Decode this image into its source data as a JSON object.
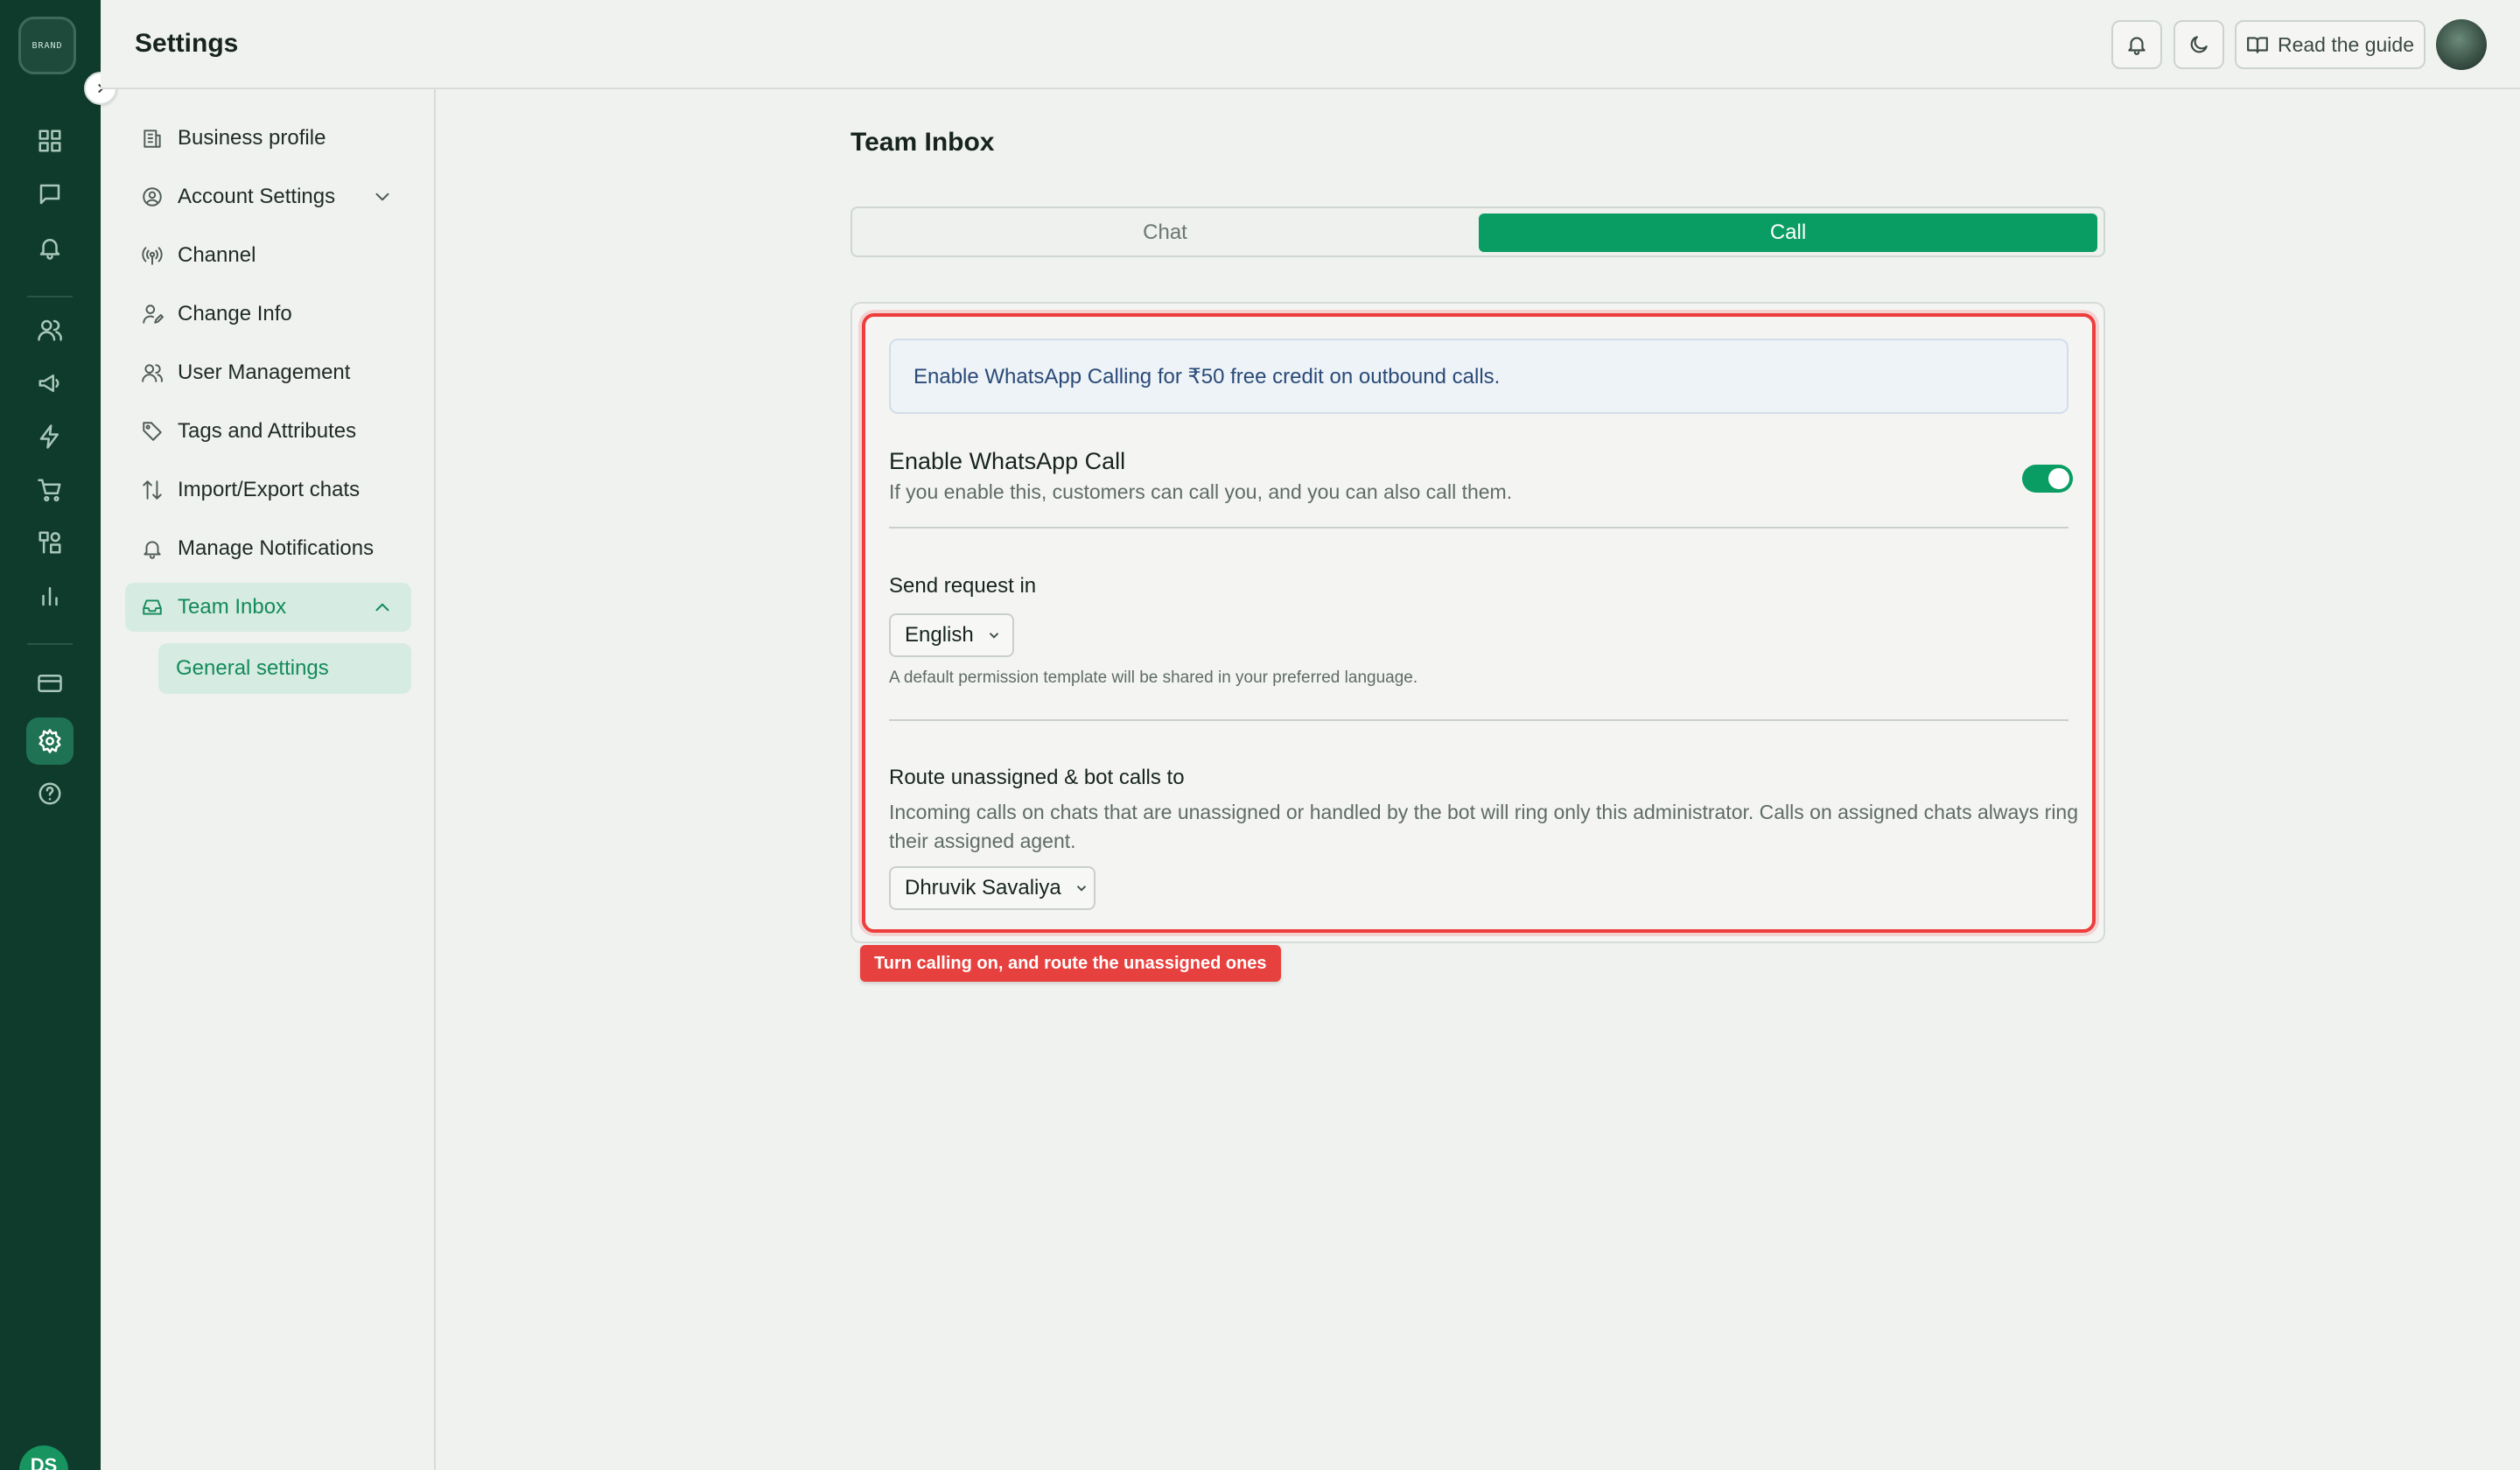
{
  "app": {
    "logo_text": "BRAND",
    "user_initials": "DS"
  },
  "header": {
    "title": "Settings",
    "guide_label": "Read the guide"
  },
  "rail": {
    "icons": [
      "dashboard-icon",
      "chat-icon",
      "bell-icon",
      "contacts-icon",
      "megaphone-icon",
      "lightning-icon",
      "cart-icon",
      "integrations-icon",
      "analytics-icon",
      "billing-icon",
      "settings-icon",
      "help-icon"
    ],
    "active": "settings-icon"
  },
  "nav": {
    "items": [
      {
        "label": "Business profile",
        "icon": "building-icon"
      },
      {
        "label": "Account Settings",
        "icon": "user-circle-icon"
      },
      {
        "label": "Channel",
        "icon": "broadcast-icon"
      },
      {
        "label": "Change Info",
        "icon": "user-edit-icon"
      },
      {
        "label": "User Management",
        "icon": "users-icon"
      },
      {
        "label": "Tags and Attributes",
        "icon": "tag-icon"
      },
      {
        "label": "Import/Export chats",
        "icon": "arrows-updown-icon"
      },
      {
        "label": "Manage Notifications",
        "icon": "bell-icon"
      },
      {
        "label": "Team Inbox",
        "icon": "inbox-icon"
      }
    ],
    "sub_item": "General settings"
  },
  "main": {
    "title": "Team Inbox",
    "tabs": [
      {
        "label": "Chat",
        "selected": false
      },
      {
        "label": "Call",
        "selected": true
      }
    ],
    "promo": "Enable WhatsApp Calling for ₹50 free credit on outbound calls.",
    "enable_call": {
      "title": "Enable WhatsApp Call",
      "description": "If you enable this, customers can call you, and you can also call them.",
      "enabled": true
    },
    "send_request": {
      "title": "Send request in",
      "value": "English",
      "hint": "A default permission template will be shared in your preferred language."
    },
    "route": {
      "title": "Route unassigned & bot calls to",
      "description": "Incoming calls on chats that are unassigned or handled by the bot will ring only this administrator. Calls on assigned chats always ring their assigned agent.",
      "value": "Dhruvik Savaliya"
    },
    "callout": "Turn calling on, and route the unassigned ones"
  },
  "colors": {
    "accent": "#0a9d63",
    "rail": "#0e3b2c",
    "highlight": "#ee3d3d"
  }
}
